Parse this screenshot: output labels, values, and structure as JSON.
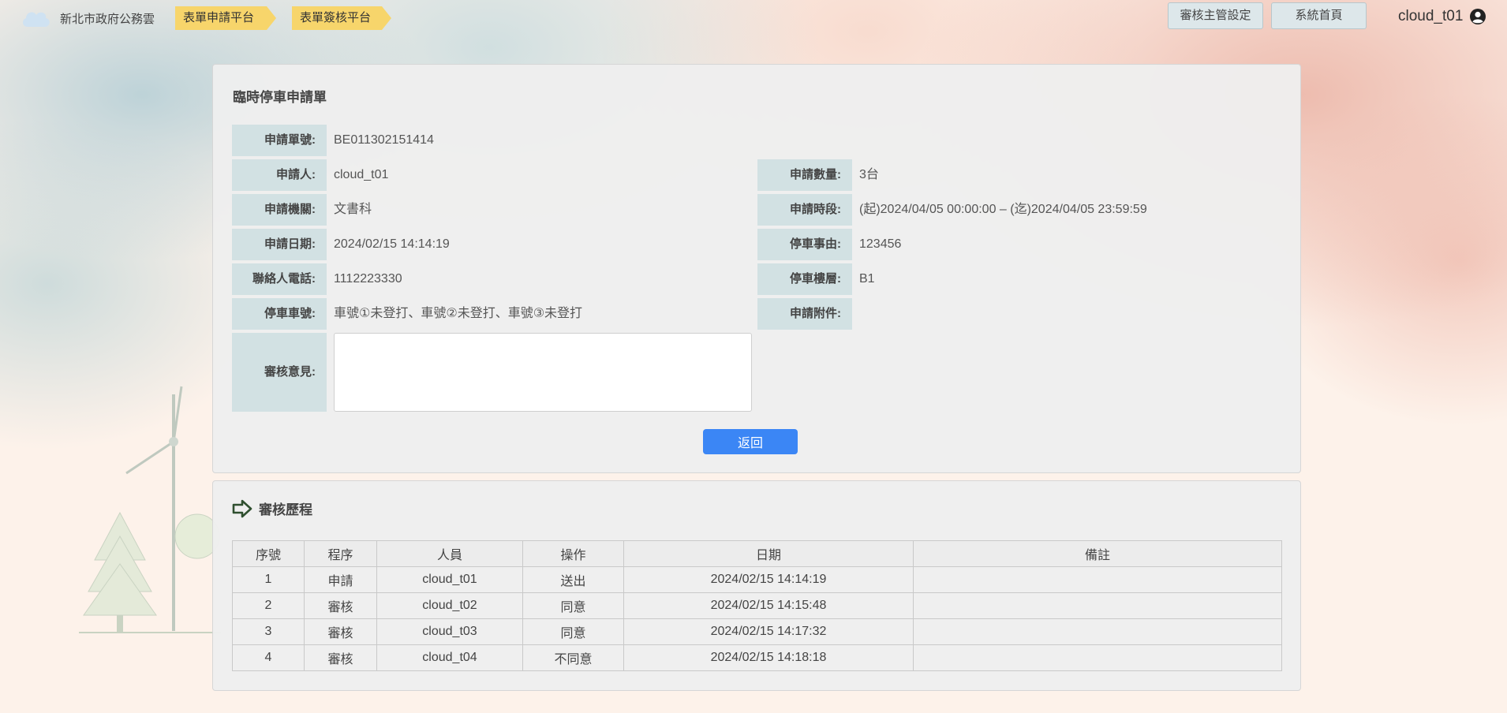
{
  "header": {
    "brand": "新北市政府公務雲",
    "crumbs": [
      "表單申請平台",
      "表單簽核平台"
    ],
    "buttons": {
      "supervisor_settings": "審核主管設定",
      "system_home": "系統首頁"
    },
    "user": "cloud_t01"
  },
  "form": {
    "title": "臨時停車申請單",
    "left": [
      {
        "label": "申請單號:",
        "value": "BE011302151414"
      },
      {
        "label": "申請人:",
        "value": "cloud_t01"
      },
      {
        "label": "申請機關:",
        "value": "文書科"
      },
      {
        "label": "申請日期:",
        "value": "2024/02/15 14:14:19"
      },
      {
        "label": "聯絡人電話:",
        "value": "1112223330"
      },
      {
        "label": "停車車號:",
        "value": "車號①未登打、車號②未登打、車號③未登打"
      }
    ],
    "right": [
      {
        "label": "申請數量:",
        "value": "3台"
      },
      {
        "label": "申請時段:",
        "value": "(起)2024/04/05 00:00:00 – (迄)2024/04/05 23:59:59"
      },
      {
        "label": "停車事由:",
        "value": "123456"
      },
      {
        "label": "停車樓層:",
        "value": "B1"
      },
      {
        "label": "申請附件:",
        "value": ""
      }
    ],
    "comment": {
      "label": "審核意見:",
      "value": ""
    },
    "back_label": "返回"
  },
  "history": {
    "title": "審核歷程",
    "columns": [
      "序號",
      "程序",
      "人員",
      "操作",
      "日期",
      "備註"
    ],
    "rows": [
      [
        "1",
        "申請",
        "cloud_t01",
        "送出",
        "2024/02/15 14:14:19",
        ""
      ],
      [
        "2",
        "審核",
        "cloud_t02",
        "同意",
        "2024/02/15 14:15:48",
        ""
      ],
      [
        "3",
        "審核",
        "cloud_t03",
        "同意",
        "2024/02/15 14:17:32",
        ""
      ],
      [
        "4",
        "審核",
        "cloud_t04",
        "不同意",
        "2024/02/15 14:18:18",
        ""
      ]
    ]
  },
  "colors": {
    "crumb": "#f7d56b",
    "label_bg": "#d2e1e3",
    "primary_button": "#3b86f5"
  },
  "icons": {
    "brand": "cloud-icon",
    "user": "user-circle-icon",
    "history": "arrow-right-icon"
  }
}
